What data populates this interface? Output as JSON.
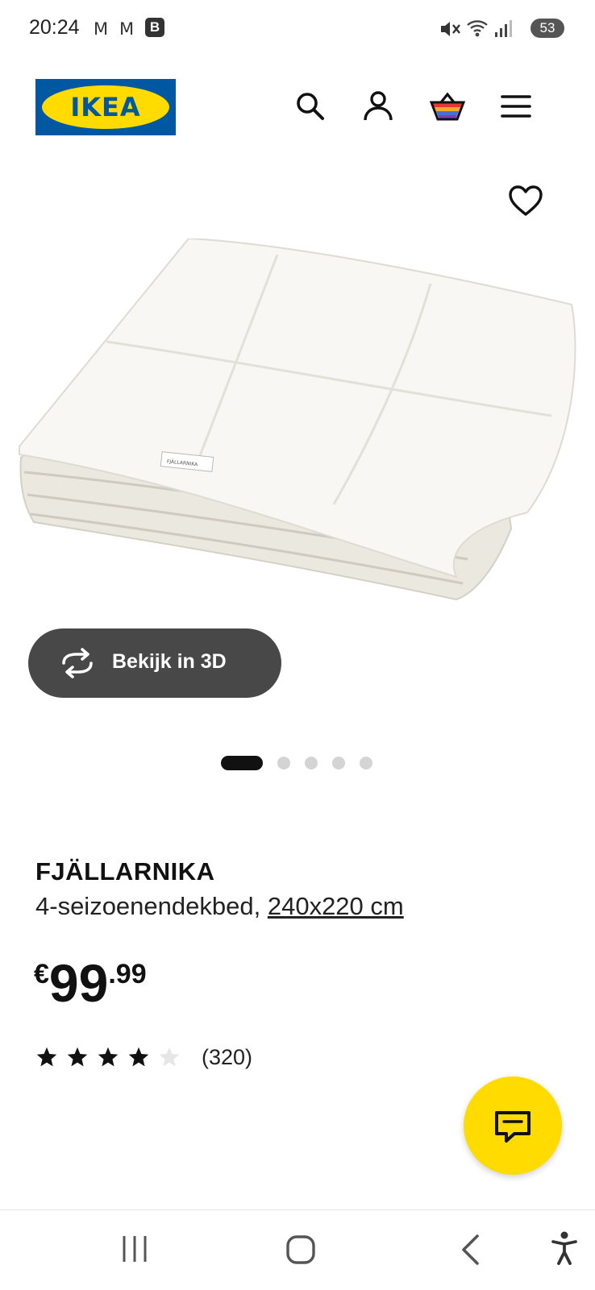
{
  "status_bar": {
    "time": "20:24",
    "notif_icons": [
      "gmail-icon",
      "gmail-icon",
      "b-app-icon"
    ],
    "b_label": "B",
    "m_label": "M",
    "battery": "53",
    "system_icons": [
      "mute-icon",
      "wifi-icon",
      "signal-icon"
    ]
  },
  "header": {
    "logo_text": "IKEA",
    "icons": [
      "search-icon",
      "account-icon",
      "cart-icon",
      "menu-icon"
    ]
  },
  "gallery": {
    "label_text": "FJÄLLARNIKA",
    "view_3d_label": "Bekijk in 3D",
    "slide_count": 5,
    "active_slide": 1
  },
  "product": {
    "name": "FJÄLLARNIKA",
    "description": "4-seizoenendekbed,",
    "size": "240x220 cm",
    "currency": "€",
    "price_int": "99",
    "price_dec": ".99",
    "rating": 4,
    "rating_max": 5,
    "review_count": "(320)"
  },
  "colors": {
    "ikea_blue": "#0058a3",
    "ikea_yellow": "#ffdb00",
    "button_dark": "#484848"
  },
  "nav": [
    "recent-apps-icon",
    "home-icon",
    "back-icon",
    "accessibility-icon"
  ]
}
